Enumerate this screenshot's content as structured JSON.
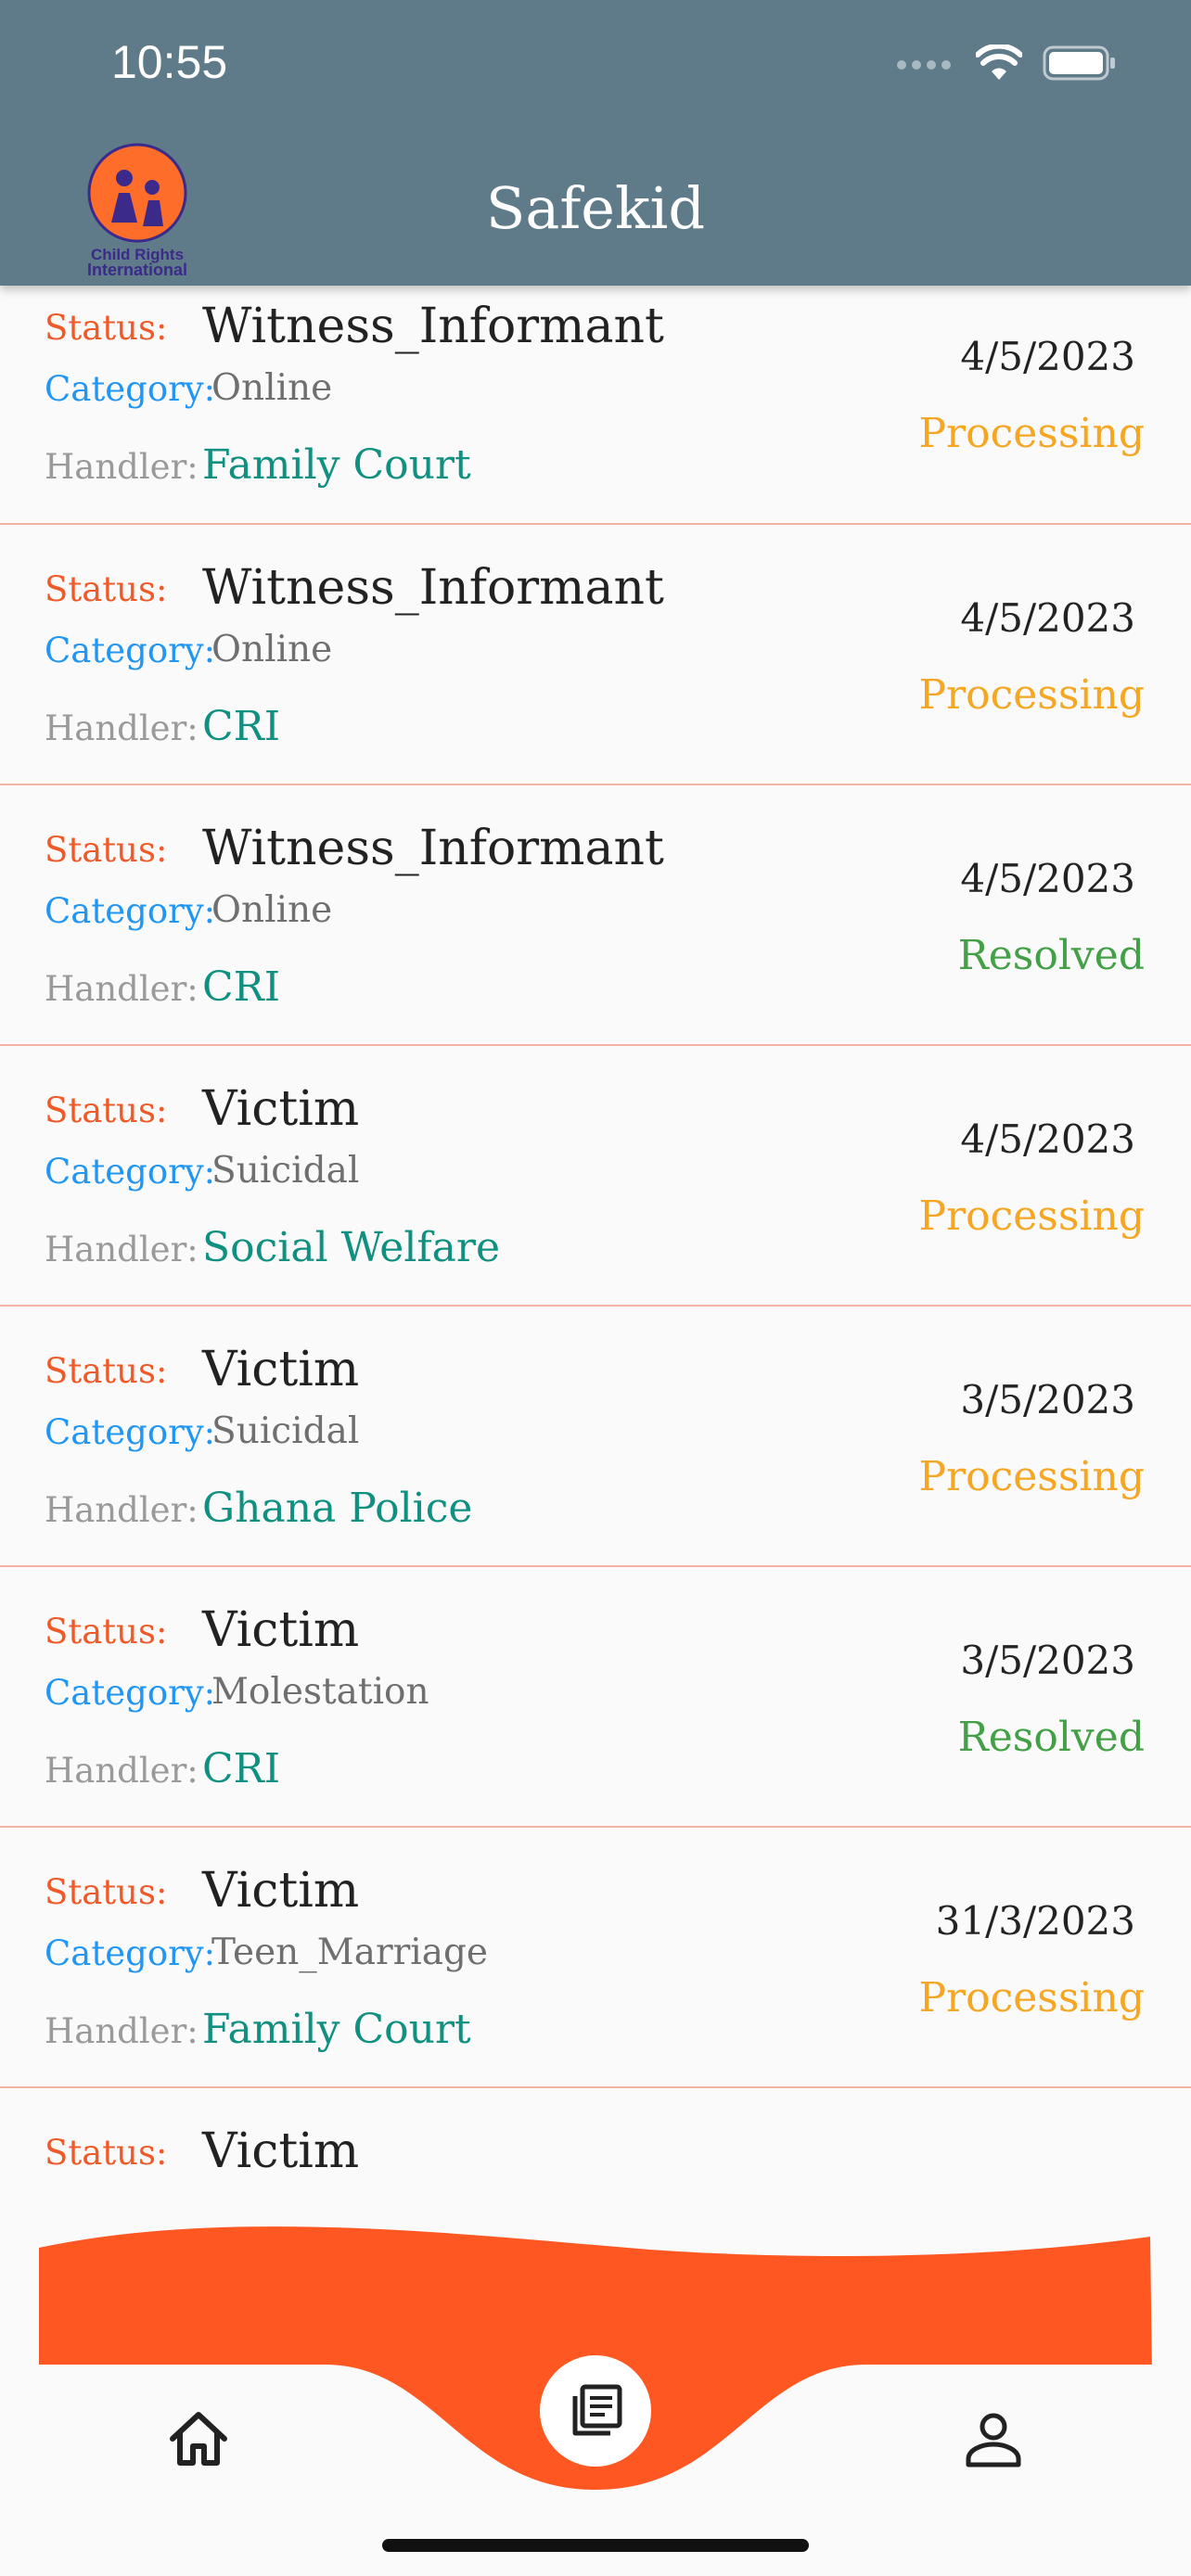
{
  "status_bar": {
    "time": "10:55"
  },
  "header": {
    "title": "Safekid",
    "logo_text_1": "Child Rights",
    "logo_text_2": "International"
  },
  "labels": {
    "status": "Status:",
    "category": "Category:",
    "handler": "Handler:"
  },
  "reports": [
    {
      "status": "Witness_Informant",
      "category": "Online",
      "handler": "Family Court",
      "date": "4/5/2023",
      "state": "Processing"
    },
    {
      "status": "Witness_Informant",
      "category": "Online",
      "handler": "CRI",
      "date": "4/5/2023",
      "state": "Processing"
    },
    {
      "status": "Witness_Informant",
      "category": "Online",
      "handler": "CRI",
      "date": "4/5/2023",
      "state": "Resolved"
    },
    {
      "status": "Victim",
      "category": "Suicidal",
      "handler": "Social Welfare",
      "date": "4/5/2023",
      "state": "Processing"
    },
    {
      "status": "Victim",
      "category": "Suicidal",
      "handler": "Ghana Police",
      "date": "3/5/2023",
      "state": "Processing"
    },
    {
      "status": "Victim",
      "category": "Molestation",
      "handler": "CRI",
      "date": "3/5/2023",
      "state": "Resolved"
    },
    {
      "status": "Victim",
      "category": "Teen_Marriage",
      "handler": "Family Court",
      "date": "31/3/2023",
      "state": "Processing"
    },
    {
      "status": "Victim"
    }
  ],
  "nav": {
    "items": [
      "home-icon",
      "reports-icon",
      "profile-icon"
    ]
  },
  "colors": {
    "header": "#5f7b89",
    "accent": "#ff5722",
    "processing": "#f5a623",
    "resolved": "#43a047",
    "handler": "#109080"
  }
}
